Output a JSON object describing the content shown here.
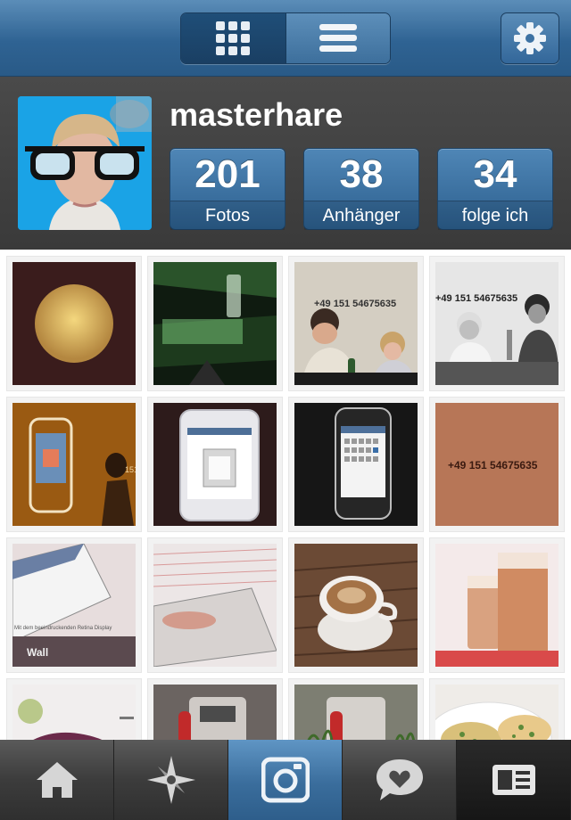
{
  "header": {
    "view_toggle": {
      "grid_icon": "grid-icon",
      "list_icon": "list-icon",
      "selected": "grid"
    },
    "settings_icon": "gear-icon"
  },
  "profile": {
    "username": "masterhare",
    "stats": [
      {
        "value": "201",
        "label": "Fotos"
      },
      {
        "value": "38",
        "label": "Anhänger"
      },
      {
        "value": "34",
        "label": "folge ich"
      }
    ]
  },
  "photo_texts": {
    "tile_3": "+49 151 54675635",
    "tile_4": "+49 151 54675635",
    "tile_5": "151",
    "tile_8": "+49 151 54675635",
    "tile_9": "Mit dem beeindruckenden Retina Display",
    "tile_9_logo": "Wall"
  },
  "tabbar": {
    "items": [
      {
        "icon": "home-icon"
      },
      {
        "icon": "explore-star-icon"
      },
      {
        "icon": "camera-icon",
        "active": true
      },
      {
        "icon": "news-heart-icon"
      },
      {
        "icon": "profile-card-icon"
      }
    ]
  },
  "colors": {
    "accent": "#3a6d9c",
    "profile_bg": "#404040"
  }
}
